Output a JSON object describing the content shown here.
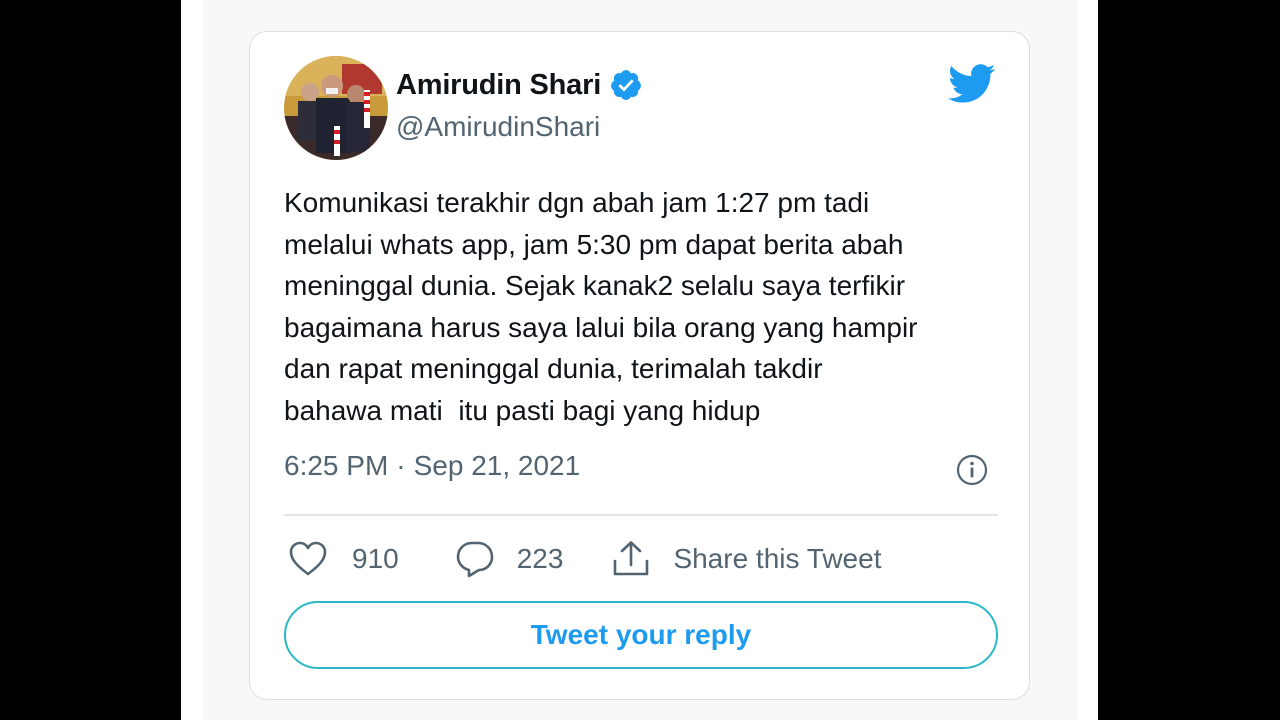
{
  "tweet": {
    "display_name": "Amirudin Shari",
    "handle": "@AmirudinShari",
    "text": "Komunikasi terakhir dgn abah jam 1:27 pm tadi\nmelalui whats app, jam 5:30 pm dapat berita abah\nmeninggal dunia. Sejak kanak2 selalu saya terfikir\nbagaimana harus saya lalui bila orang yang hampir\ndan rapat meninggal dunia, terimalah takdir\nbahawa mati  itu pasti bagi yang hidup",
    "time": "6:25 PM",
    "separator": "·",
    "date": "Sep 21, 2021"
  },
  "actions": {
    "likes_count": "910",
    "replies_count": "223",
    "share_label": "Share this Tweet"
  },
  "reply_button_label": "Tweet your reply",
  "icons": {
    "verified": "verified-badge-icon",
    "logo": "twitter-bird-icon",
    "info": "info-icon",
    "like": "heart-icon",
    "reply": "speech-bubble-icon",
    "share": "share-upload-icon"
  },
  "colors": {
    "twitter_blue": "#1d9bf0",
    "text_primary": "#0f1419",
    "text_secondary": "#536471",
    "reply_button_border": "#2ab7c8"
  }
}
